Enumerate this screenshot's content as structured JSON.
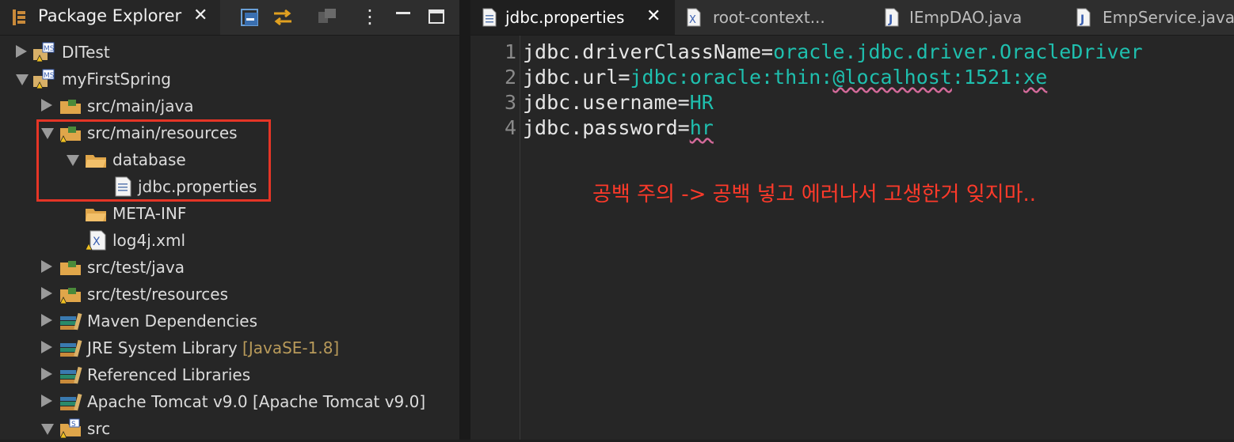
{
  "package_explorer": {
    "title": "Package Explorer",
    "tree": [
      {
        "label": "DITest",
        "expanded": false,
        "icon": "maven-spring-project-icon"
      },
      {
        "label": "myFirstSpring",
        "expanded": true,
        "icon": "maven-spring-project-icon"
      },
      {
        "label": "src/main/java",
        "expanded": false,
        "icon": "source-folder-icon"
      },
      {
        "label": "src/main/resources",
        "expanded": true,
        "icon": "source-folder-icon"
      },
      {
        "label": "database",
        "expanded": true,
        "icon": "folder-icon"
      },
      {
        "label": "jdbc.properties",
        "icon": "properties-file-icon"
      },
      {
        "label": "META-INF",
        "icon": "folder-icon"
      },
      {
        "label": "log4j.xml",
        "icon": "xml-file-icon"
      },
      {
        "label": "src/test/java",
        "expanded": false,
        "icon": "source-folder-icon"
      },
      {
        "label": "src/test/resources",
        "expanded": false,
        "icon": "source-folder-icon"
      },
      {
        "label": "Maven Dependencies",
        "expanded": false,
        "icon": "library-icon"
      },
      {
        "label": "JRE System Library",
        "decoration": "[JavaSE-1.8]",
        "expanded": false,
        "icon": "library-icon"
      },
      {
        "label": "Referenced Libraries",
        "expanded": false,
        "icon": "library-icon"
      },
      {
        "label": "Apache Tomcat v9.0 [Apache Tomcat v9.0]",
        "expanded": false,
        "icon": "library-icon"
      },
      {
        "label": "src",
        "expanded": true,
        "icon": "folder-icon"
      }
    ]
  },
  "editor_tabs": [
    {
      "label": "jdbc.properties",
      "active": true,
      "icon": "properties-file-icon"
    },
    {
      "label": "root-context...",
      "active": false,
      "icon": "xml-file-icon"
    },
    {
      "label": "IEmpDAO.java",
      "active": false,
      "icon": "java-file-icon"
    },
    {
      "label": "EmpService.java",
      "active": false,
      "icon": "java-file-icon"
    }
  ],
  "editor": {
    "lines": [
      {
        "num": "1",
        "key": "jdbc.driverClassName=",
        "value": "oracle.jdbc.driver.OracleDriver"
      },
      {
        "num": "2",
        "key": "jdbc.url=",
        "value_a": "jdbc:oracle:thin:",
        "value_b": "@localhost",
        "value_c": ":1521:",
        "value_d": "xe"
      },
      {
        "num": "3",
        "key": "jdbc.username=",
        "value": "HR"
      },
      {
        "num": "4",
        "key": "jdbc.password=",
        "value": "hr"
      }
    ],
    "annotation": "공백 주의 -> 공백 넣고 에러나서 고생한거 잊지마.."
  },
  "colors": {
    "annotation": "#ff3a2a",
    "highlight_box": "#e53526",
    "value": "#1fbfae"
  }
}
